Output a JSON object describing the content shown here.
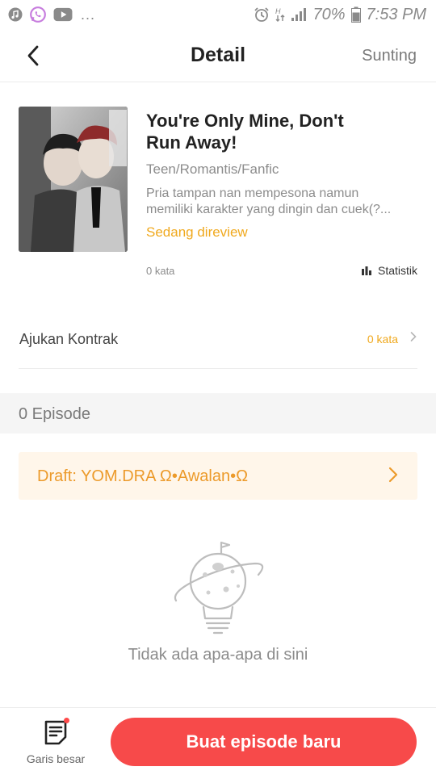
{
  "status_bar": {
    "left_icons": [
      "music-note-icon",
      "whatsapp-icon",
      "youtube-icon"
    ],
    "overflow": "...",
    "battery": "70%",
    "time": "7:53 PM"
  },
  "header": {
    "title": "Detail",
    "edit_label": "Sunting"
  },
  "book": {
    "title": "You're Only Mine, Don't Run Away!",
    "title_line1": "You're Only Mine, Don't",
    "title_line2": "Run Away!",
    "genre": "Teen/Romantis/Fanfic",
    "desc_line1": "Pria tampan nan mempesona namun",
    "desc_line2": "memiliki karakter yang dingin dan cuek(?...",
    "status": "Sedang direview",
    "word_count": "0 kata",
    "stats_label": "Statistik"
  },
  "contract": {
    "label": "Ajukan Kontrak",
    "value": "0 kata"
  },
  "episodes": {
    "count_label": "0 Episode",
    "draft_label": "Draft: YOM.DRA Ω•Awalan•Ω"
  },
  "empty_state": {
    "text": "Tidak ada apa-apa di sini"
  },
  "bottom_bar": {
    "outline_label": "Garis besar",
    "new_episode_label": "Buat episode baru"
  },
  "colors": {
    "accent": "#f74a4a",
    "status_orange": "#f0a91e",
    "draft_bg": "#fff6ea"
  }
}
